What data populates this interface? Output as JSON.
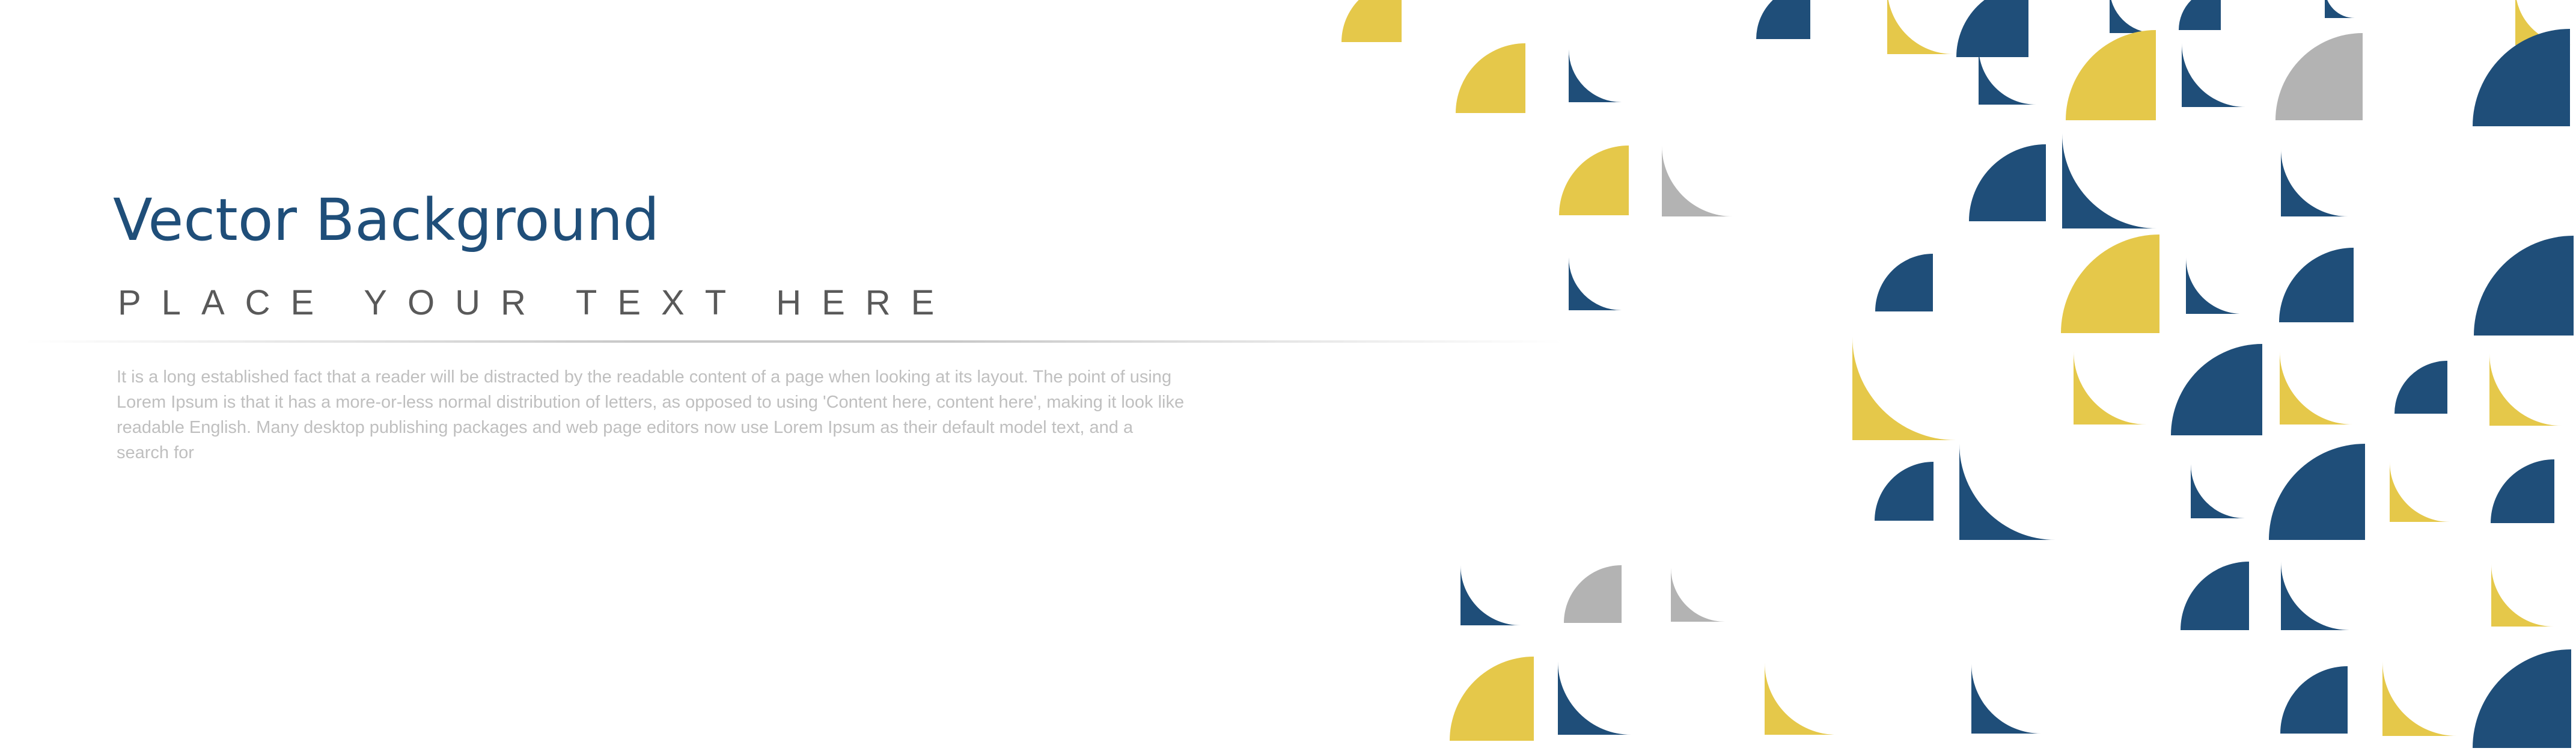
{
  "slide": {
    "title": "Vector Background",
    "subtitle": "PLACE YOUR TEXT HERE",
    "body": "It is a long established fact that a reader will be distracted by the readable content of a page when looking at its layout. The point of using Lorem Ipsum is that it has a more-or-less normal distribution of letters, as opposed to using 'Content here, content here', making it look like readable English. Many desktop publishing packages and web page editors now use Lorem Ipsum as their default model text, and a search for"
  },
  "colors": {
    "navy": "#1f4e79",
    "yellow": "#e5c84a",
    "gray": "#b3b3b3",
    "title": "#1f4e79",
    "subtitle": "#595959",
    "body": "#bfbfbf"
  }
}
